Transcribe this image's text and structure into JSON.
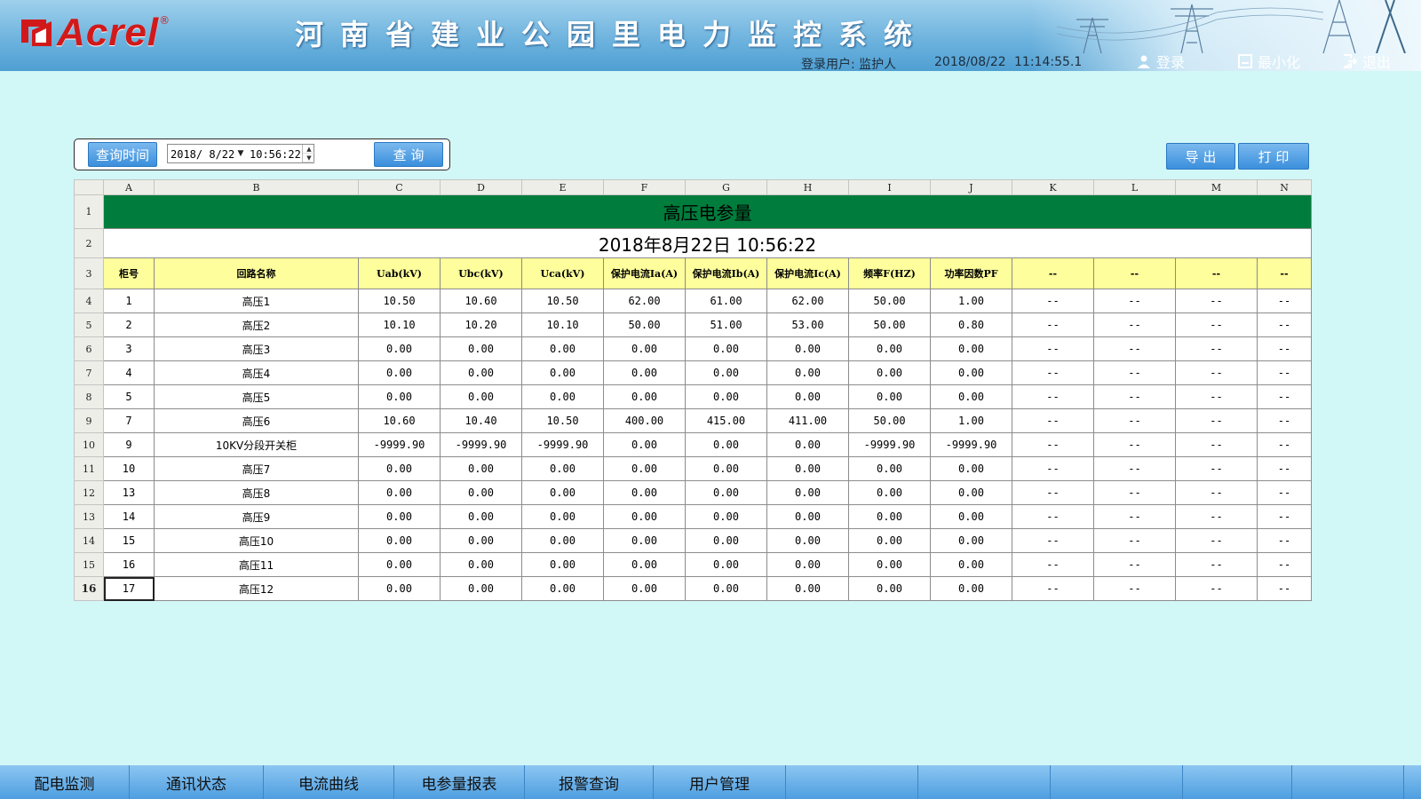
{
  "header": {
    "logo_text": "Acrel",
    "logo_reg": "®",
    "title": "河南省建业公园里电力监控系统",
    "login_user": "登录用户: 监护人",
    "date": "2018/08/22",
    "time": "11:14:55.1",
    "login_label": "登录",
    "minimize_label": "最小化",
    "exit_label": "退出"
  },
  "query": {
    "time_label": "查询时间",
    "date_value": "2018/ 8/22",
    "time_value": "10:56:22",
    "query_button": "查 询"
  },
  "actions": {
    "export_label": "导 出",
    "print_label": "打 印"
  },
  "sheet": {
    "col_letters": [
      "A",
      "B",
      "C",
      "D",
      "E",
      "F",
      "G",
      "H",
      "I",
      "J",
      "K",
      "L",
      "M",
      "N"
    ],
    "title": "高压电参量",
    "datetime": "2018年8月22日  10:56:22",
    "headers": [
      "柜号",
      "回路名称",
      "Uab(kV)",
      "Ubc(kV)",
      "Uca(kV)",
      "保护电流Ia(A)",
      "保护电流Ib(A)",
      "保护电流Ic(A)",
      "频率F(HZ)",
      "功率因数PF",
      "--",
      "--",
      "--",
      "--"
    ],
    "rows": [
      [
        "1",
        "高压1",
        "10.50",
        "10.60",
        "10.50",
        "62.00",
        "61.00",
        "62.00",
        "50.00",
        "1.00",
        "--",
        "--",
        "--",
        "--"
      ],
      [
        "2",
        "高压2",
        "10.10",
        "10.20",
        "10.10",
        "50.00",
        "51.00",
        "53.00",
        "50.00",
        "0.80",
        "--",
        "--",
        "--",
        "--"
      ],
      [
        "3",
        "高压3",
        "0.00",
        "0.00",
        "0.00",
        "0.00",
        "0.00",
        "0.00",
        "0.00",
        "0.00",
        "--",
        "--",
        "--",
        "--"
      ],
      [
        "4",
        "高压4",
        "0.00",
        "0.00",
        "0.00",
        "0.00",
        "0.00",
        "0.00",
        "0.00",
        "0.00",
        "--",
        "--",
        "--",
        "--"
      ],
      [
        "5",
        "高压5",
        "0.00",
        "0.00",
        "0.00",
        "0.00",
        "0.00",
        "0.00",
        "0.00",
        "0.00",
        "--",
        "--",
        "--",
        "--"
      ],
      [
        "7",
        "高压6",
        "10.60",
        "10.40",
        "10.50",
        "400.00",
        "415.00",
        "411.00",
        "50.00",
        "1.00",
        "--",
        "--",
        "--",
        "--"
      ],
      [
        "9",
        "10KV分段开关柜",
        "-9999.90",
        "-9999.90",
        "-9999.90",
        "0.00",
        "0.00",
        "0.00",
        "-9999.90",
        "-9999.90",
        "--",
        "--",
        "--",
        "--"
      ],
      [
        "10",
        "高压7",
        "0.00",
        "0.00",
        "0.00",
        "0.00",
        "0.00",
        "0.00",
        "0.00",
        "0.00",
        "--",
        "--",
        "--",
        "--"
      ],
      [
        "13",
        "高压8",
        "0.00",
        "0.00",
        "0.00",
        "0.00",
        "0.00",
        "0.00",
        "0.00",
        "0.00",
        "--",
        "--",
        "--",
        "--"
      ],
      [
        "14",
        "高压9",
        "0.00",
        "0.00",
        "0.00",
        "0.00",
        "0.00",
        "0.00",
        "0.00",
        "0.00",
        "--",
        "--",
        "--",
        "--"
      ],
      [
        "15",
        "高压10",
        "0.00",
        "0.00",
        "0.00",
        "0.00",
        "0.00",
        "0.00",
        "0.00",
        "0.00",
        "--",
        "--",
        "--",
        "--"
      ],
      [
        "16",
        "高压11",
        "0.00",
        "0.00",
        "0.00",
        "0.00",
        "0.00",
        "0.00",
        "0.00",
        "0.00",
        "--",
        "--",
        "--",
        "--"
      ],
      [
        "17",
        "高压12",
        "0.00",
        "0.00",
        "0.00",
        "0.00",
        "0.00",
        "0.00",
        "0.00",
        "0.00",
        "--",
        "--",
        "--",
        "--"
      ]
    ]
  },
  "nav": {
    "items": [
      "配电监测",
      "通讯状态",
      "电流曲线",
      "电参量报表",
      "报警查询",
      "用户管理",
      "",
      "",
      "",
      "",
      ""
    ]
  },
  "colors": {
    "title_bg": "#007d3c",
    "header_bg": "#fefe9c",
    "page_bg": "#d2f7f7",
    "button_blue": "#3b8fdc"
  }
}
